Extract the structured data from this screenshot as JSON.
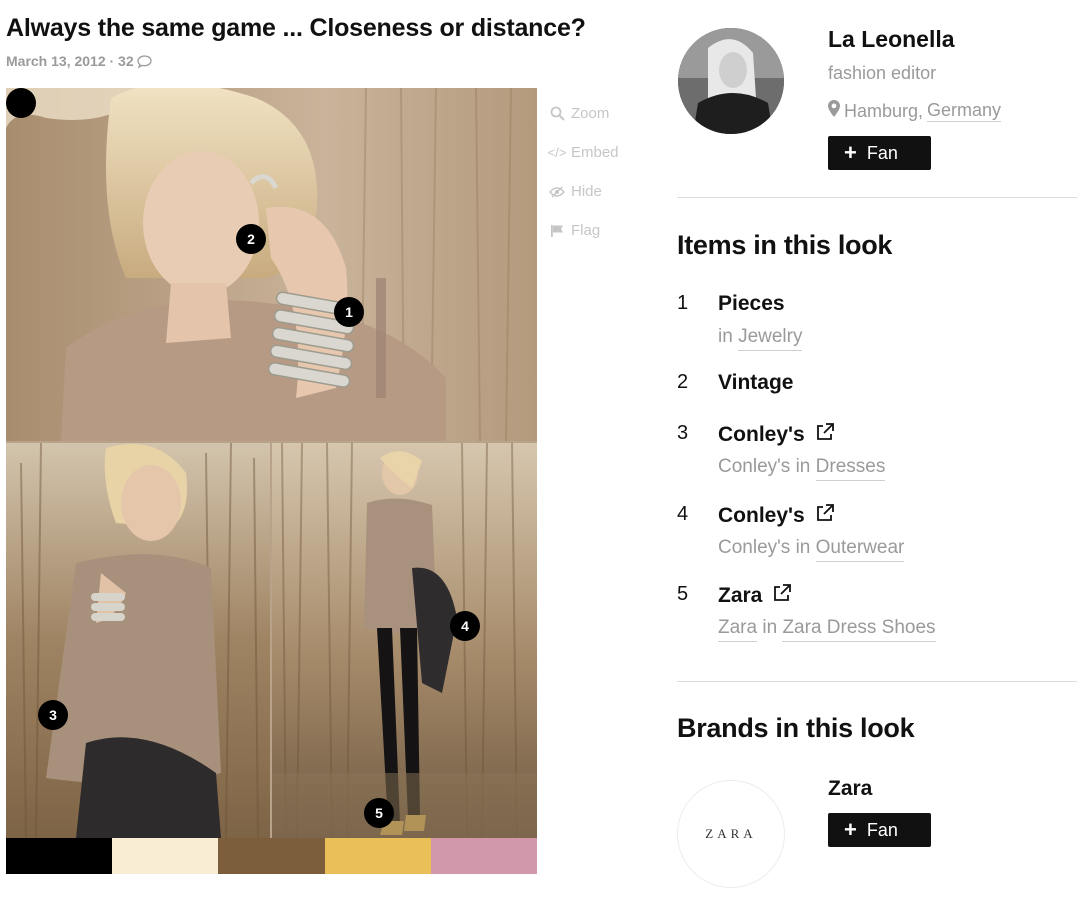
{
  "post": {
    "title": "Always the same game ... Closeness or distance?",
    "date": "March 13, 2012 · 32",
    "comment_icon": "speech-bubble-icon"
  },
  "photo": {
    "markers": [
      "1",
      "2",
      "3",
      "4",
      "5"
    ]
  },
  "palette": [
    "#000000",
    "#f9edd3",
    "#7c5d3c",
    "#ebbf58",
    "#d198ac"
  ],
  "actions": [
    {
      "label": "Zoom",
      "icon": "zoom-icon"
    },
    {
      "label": "Embed",
      "icon": "embed-icon"
    },
    {
      "label": "Hide",
      "icon": "eye-slash-icon"
    },
    {
      "label": "Flag",
      "icon": "flag-icon"
    }
  ],
  "profile": {
    "name": "La Leonella",
    "role": "fashion editor",
    "city": "Hamburg,",
    "country": "Germany",
    "fan_label": "Fan"
  },
  "items_section": {
    "title": "Items in this look",
    "items": [
      {
        "num": "1",
        "name": "Pieces",
        "sub_prefix": "in",
        "sub_link": "Jewelry"
      },
      {
        "num": "2",
        "name": "Vintage"
      },
      {
        "num": "3",
        "name": "Conley's",
        "sub_brand": "Conley's",
        "sub_prefix": "in",
        "sub_link": "Dresses"
      },
      {
        "num": "4",
        "name": "Conley's",
        "sub_brand": "Conley's",
        "sub_prefix": "in",
        "sub_link": "Outerwear"
      },
      {
        "num": "5",
        "name": "Zara",
        "sub_brand": "Zara",
        "sub_prefix": "in",
        "sub_link": "Zara Dress Shoes"
      }
    ]
  },
  "brands_section": {
    "title": "Brands in this look",
    "brand_name": "Zara",
    "brand_logo_text": "ZARA",
    "fan_label": "Fan"
  }
}
